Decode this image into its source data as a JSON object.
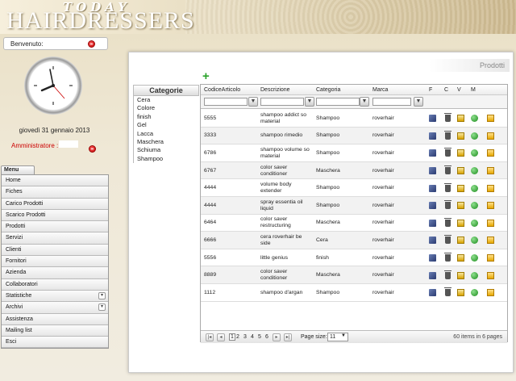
{
  "header": {
    "logo_top": "TODAY",
    "logo_main": "HAIRDRESSERS"
  },
  "welcome": {
    "label": "Benvenuto:"
  },
  "date": "giovedì 31 gennaio 2013",
  "admin": {
    "label": "Amministratore :"
  },
  "menu": {
    "tab": "Menu",
    "items": [
      {
        "label": "Home",
        "expandable": false
      },
      {
        "label": "Fiches",
        "expandable": false
      },
      {
        "label": "Carico Prodotti",
        "expandable": false
      },
      {
        "label": "Scarico Prodotti",
        "expandable": false
      },
      {
        "label": "Prodotti",
        "expandable": false
      },
      {
        "label": "Servizi",
        "expandable": false
      },
      {
        "label": "Clienti",
        "expandable": false
      },
      {
        "label": "Fornitori",
        "expandable": false
      },
      {
        "label": "Azienda",
        "expandable": false
      },
      {
        "label": "Collaboratori",
        "expandable": false
      },
      {
        "label": "Statistiche",
        "expandable": true
      },
      {
        "label": "Archivi",
        "expandable": true
      },
      {
        "label": "Assistenza",
        "expandable": false
      },
      {
        "label": "Mailing list",
        "expandable": false
      },
      {
        "label": "Esci",
        "expandable": false
      }
    ]
  },
  "panel": {
    "title": "Prodotti"
  },
  "categories": {
    "header": "Categorie",
    "items": [
      "Cera",
      "Colore",
      "finish",
      "Gel",
      "Lacca",
      "Maschera",
      "Schiuma",
      "Shampoo"
    ]
  },
  "grid": {
    "columns": {
      "codice": "CodiceArticolo",
      "descrizione": "Descrizione",
      "categoria": "Categoria",
      "marca": "Marca",
      "f": "F",
      "c": "C",
      "v": "V",
      "m": "M"
    },
    "rows": [
      {
        "codice": "5555",
        "descrizione": "shampoo addict so material",
        "categoria": "Shampoo",
        "marca": "roverhair"
      },
      {
        "codice": "3333",
        "descrizione": "shampoo rimedio",
        "categoria": "Shampoo",
        "marca": "roverhair"
      },
      {
        "codice": "6786",
        "descrizione": "shampoo volume so material",
        "categoria": "Shampoo",
        "marca": "roverhair"
      },
      {
        "codice": "6767",
        "descrizione": "color saver conditioner",
        "categoria": "Maschera",
        "marca": "roverhair"
      },
      {
        "codice": "4444",
        "descrizione": "volume body extender",
        "categoria": "Shampoo",
        "marca": "roverhair"
      },
      {
        "codice": "4444",
        "descrizione": "spray essentia oil liquid",
        "categoria": "Shampoo",
        "marca": "roverhair"
      },
      {
        "codice": "6464",
        "descrizione": "color saver restructuring",
        "categoria": "Maschera",
        "marca": "roverhair"
      },
      {
        "codice": "6666",
        "descrizione": "cera roverhair be side",
        "categoria": "Cera",
        "marca": "roverhair"
      },
      {
        "codice": "5556",
        "descrizione": "little genius",
        "categoria": "finish",
        "marca": "roverhair"
      },
      {
        "codice": "8889",
        "descrizione": "color saver conditioner",
        "categoria": "Maschera",
        "marca": "roverhair"
      },
      {
        "codice": "1112",
        "descrizione": "shampoo d'argan",
        "categoria": "Shampoo",
        "marca": "roverhair"
      }
    ]
  },
  "pager": {
    "pages": [
      "1",
      "2",
      "3",
      "4",
      "5",
      "6"
    ],
    "current": "1",
    "page_size_label": "Page size:",
    "page_size": "11",
    "items_info": "60 items in 6 pages"
  },
  "colors": {
    "admin": "#cc0000",
    "add_icon": "#2aa32a"
  }
}
